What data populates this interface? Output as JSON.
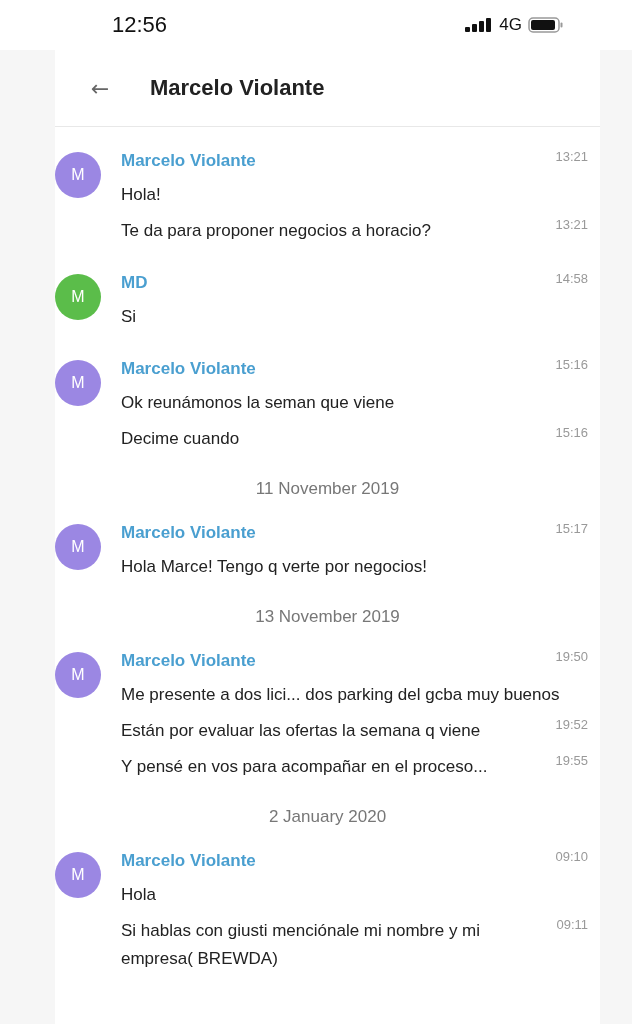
{
  "status_bar": {
    "time": "12:56",
    "network": "4G"
  },
  "header": {
    "back": "←",
    "title": "Marcelo Violante"
  },
  "feed": [
    {
      "kind": "group",
      "initial": "M",
      "color": "#9b87e3",
      "sender": "Marcelo Violante",
      "time": "13:21",
      "messages": [
        {
          "text": "Hola!"
        },
        {
          "text": "Te da para proponer negocios a horacio?",
          "time": "13:21"
        }
      ]
    },
    {
      "kind": "group",
      "initial": "M",
      "color": "#5bbd4a",
      "sender": "MD",
      "time": "14:58",
      "messages": [
        {
          "text": "Si"
        }
      ]
    },
    {
      "kind": "group",
      "initial": "M",
      "color": "#9b87e3",
      "sender": "Marcelo Violante",
      "time": "15:16",
      "messages": [
        {
          "text": "Ok reunámonos la seman que viene"
        },
        {
          "text": "Decime cuando",
          "time": "15:16"
        }
      ]
    },
    {
      "kind": "date",
      "text": "11 November 2019"
    },
    {
      "kind": "group",
      "initial": "M",
      "color": "#9b87e3",
      "sender": "Marcelo Violante",
      "time": "15:17",
      "messages": [
        {
          "text": "Hola Marce! Tengo q verte por negocios!"
        }
      ]
    },
    {
      "kind": "date",
      "text": "13 November 2019"
    },
    {
      "kind": "group",
      "initial": "M",
      "color": "#9b87e3",
      "sender": "Marcelo Violante",
      "time": "19:50",
      "messages": [
        {
          "text": "Me presente a dos lici... dos parking del gcba muy buenos"
        },
        {
          "text": "Están por evaluar las ofertas la semana q viene",
          "time": "19:52"
        },
        {
          "text": "Y pensé en vos para acompañar en el proceso...",
          "time": "19:55"
        }
      ]
    },
    {
      "kind": "date",
      "text": "2 January 2020"
    },
    {
      "kind": "group",
      "initial": "M",
      "color": "#9b87e3",
      "sender": "Marcelo Violante",
      "time": "09:10",
      "messages": [
        {
          "text": "Hola"
        },
        {
          "text": "Si hablas con giusti menciónale mi nombre y mi empresa( BREWDA)",
          "time": "09:11"
        }
      ]
    }
  ]
}
